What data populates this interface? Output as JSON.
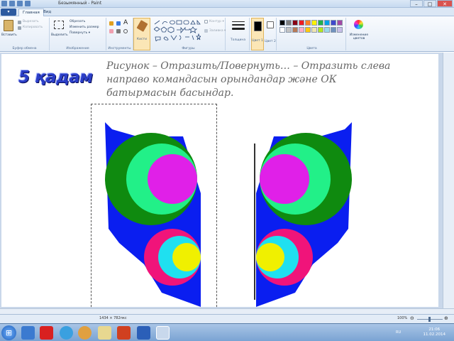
{
  "window": {
    "title": "Безымянный - Paint",
    "minimize": "–",
    "maximize": "□",
    "close": "✕"
  },
  "tabs": {
    "file": "▾",
    "home": "Главная",
    "view": "Вид"
  },
  "ribbon": {
    "clipboard": {
      "paste": "Вставить",
      "cut": "Вырезать",
      "copy": "Копировать",
      "label": "Буфер обмена"
    },
    "image": {
      "select": "Выделить",
      "crop": "Обрезать",
      "resize": "Изменить размер",
      "rotate": "Повернуть ▾",
      "label": "Изображение"
    },
    "tools": {
      "label": "Инструменты"
    },
    "brushes": {
      "label": "Кисти"
    },
    "shapes": {
      "outline": "Контур ▾",
      "fill": "Заливка ▾",
      "label": "Фигуры"
    },
    "size": {
      "label": "Толщина"
    },
    "color1": {
      "label": "Цвет 1"
    },
    "color2": {
      "label": "Цвет 2"
    },
    "colors": {
      "label": "Цвета",
      "edit": "Изменение цветов"
    }
  },
  "palette": [
    "#000000",
    "#7f7f7f",
    "#880015",
    "#ed1c24",
    "#ff7f27",
    "#fff200",
    "#22b14c",
    "#00a2e8",
    "#3f48cc",
    "#a349a4",
    "#ffffff",
    "#c3c3c3",
    "#b97a57",
    "#ffaec9",
    "#ffc90e",
    "#efe4b0",
    "#b5e61d",
    "#99d9ea",
    "#7092be",
    "#c8bfe7"
  ],
  "slide": {
    "heading": "5 қадам",
    "instruction": "Рисунок – Отразить/Повернуть… – Отразить слева направо командасын орындандар және ОК батырмасын басындар."
  },
  "status": {
    "size": "1434 × 782пкс",
    "zoom": "100%",
    "zoom_minus": "⊖",
    "zoom_plus": "⊕"
  },
  "taskbar": {
    "start": "⊞",
    "time": "21:06",
    "date": "11.02.2014",
    "lang": "RU"
  },
  "colors": {
    "accent": "#2b3ec7",
    "ribbon": "#e3ecf7",
    "canvas_bg": "#c9d7ea"
  }
}
